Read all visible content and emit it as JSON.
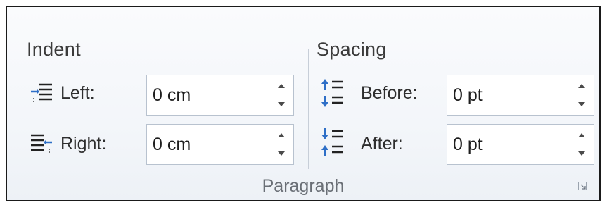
{
  "indent": {
    "title": "Indent",
    "left": {
      "label": "Left:",
      "value": "0 cm",
      "icon": "indent-left-icon"
    },
    "right": {
      "label": "Right:",
      "value": "0 cm",
      "icon": "indent-right-icon"
    }
  },
  "spacing": {
    "title": "Spacing",
    "before": {
      "label": "Before:",
      "value": "0 pt",
      "icon": "space-before-icon"
    },
    "after": {
      "label": "After:",
      "value": "0 pt",
      "icon": "space-after-icon"
    }
  },
  "group_caption": "Paragraph",
  "colors": {
    "icon_blue": "#2e6fc7",
    "frame_border": "#1a1a1a",
    "input_border": "#b8c2cf"
  }
}
